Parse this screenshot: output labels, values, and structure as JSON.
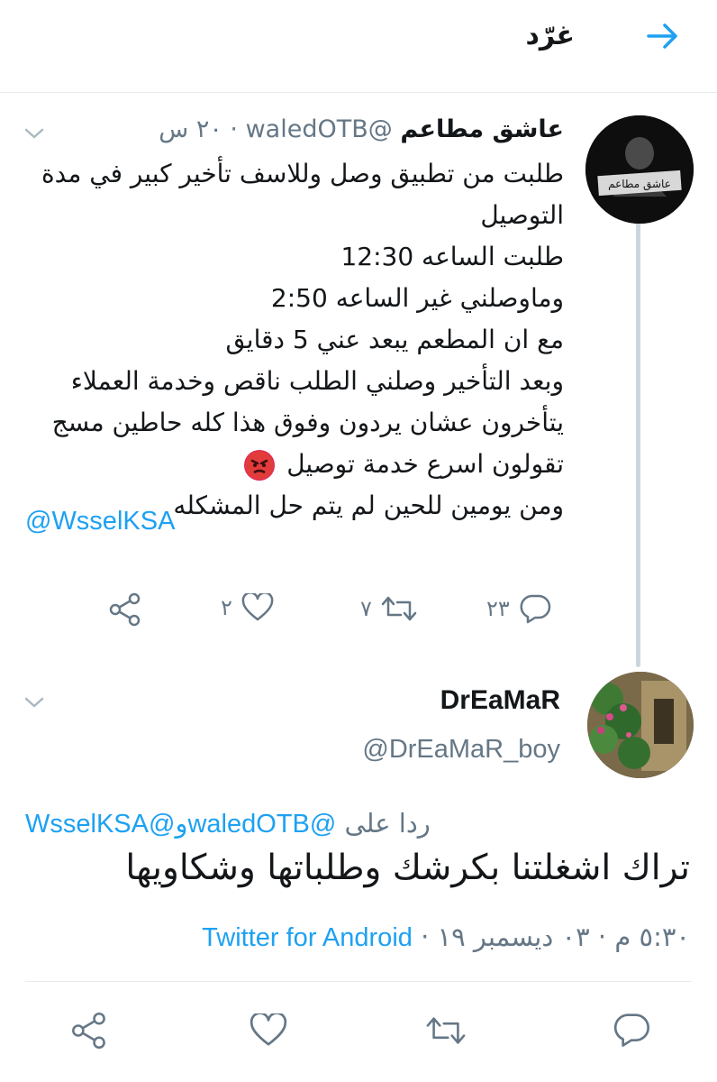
{
  "header": {
    "title": "غرّد",
    "back_icon": "arrow-right-icon",
    "accent_color": "#1da1f2"
  },
  "tweet1": {
    "author_name": "عاشق مطاعم",
    "handle": "@waledOTB",
    "time": "٢٠ س",
    "avatar_caption": "عاشق مطاعم",
    "lines": [
      "طلبت من تطبيق وصل وللاسف تأخير كبير في مدة",
      "التوصيل",
      "طلبت الساعه 12:30",
      "وماوصلني غير الساعه 2:50",
      "مع ان المطعم يبعد عني 5 دقايق",
      "وبعد التأخير وصلني الطلب ناقص وخدمة العملاء",
      "يتأخرون عشان يردون وفوق هذا كله حاطين مسج",
      "تقولون اسرع خدمة توصيل",
      "ومن يومين للحين لم يتم حل المشكله"
    ],
    "mention": "@WsselKSA",
    "replies": "٢٣",
    "retweets": "٧",
    "likes": "٢"
  },
  "tweet2": {
    "author_name": "DrEaMaR",
    "handle": "@DrEaMaR_boy",
    "reply_prefix": "ردا على",
    "reply_mention1": "@waledOTB",
    "reply_and": "و",
    "reply_mention2": "@WsselKSA",
    "text": "تراك اشغلتنا بكرشك وطلباتها وشكاويها",
    "timestamp": "٥:٣٠ م · ٠٣ ديسمبر ١٩ ·",
    "source": "Twitter for Android"
  }
}
